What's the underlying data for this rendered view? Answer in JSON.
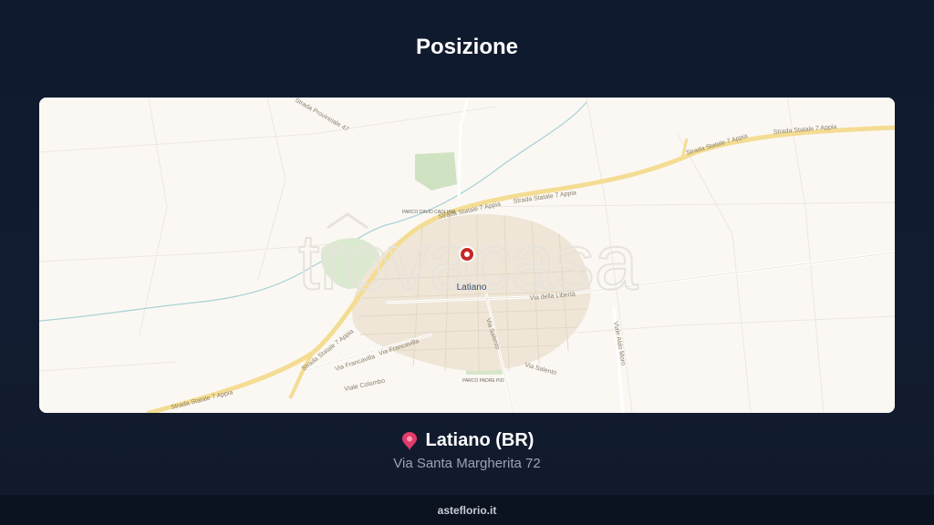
{
  "header": {
    "title": "Posizione"
  },
  "map": {
    "watermark": "trovacasa",
    "town_label": "Latiano",
    "road_labels": {
      "ss7_east": "Strada Statale 7 Appia",
      "ss7_ne": "Strada Statale 7 Appia",
      "ss7_mid": "Strada Statale 7 Appia",
      "ss7_west": "Strada Statale 7 Appia",
      "ss7_sw": "Strada Statale 7 Appia",
      "via_liberta": "Via della Libertà",
      "via_salento_1": "Via Salento",
      "via_salento_2": "Via Salento",
      "via_francavilla_1": "Via Francavilla",
      "via_francavilla_2": "Via Francavilla",
      "viale_colombo": "Viale Colombo",
      "viale_aldo_moro": "Viale Aldo Moro",
      "parco_padre_pio": "PARCO PADRE PIO",
      "parco_cagliani": "PARCO DAVID CAGLIANI",
      "sp47": "Strada Provinciale 47"
    },
    "colors": {
      "marker": "#c62828",
      "road_major": "#f4dd93",
      "land": "#fbf8f4",
      "urban": "#efe6d7",
      "green": "#cfe3c2",
      "water": "#a9d3d6"
    }
  },
  "location": {
    "icon": "pin-icon",
    "name": "Latiano (BR)",
    "address": "Via Santa Margherita 72"
  },
  "footer": {
    "site": "asteflorio.it"
  }
}
